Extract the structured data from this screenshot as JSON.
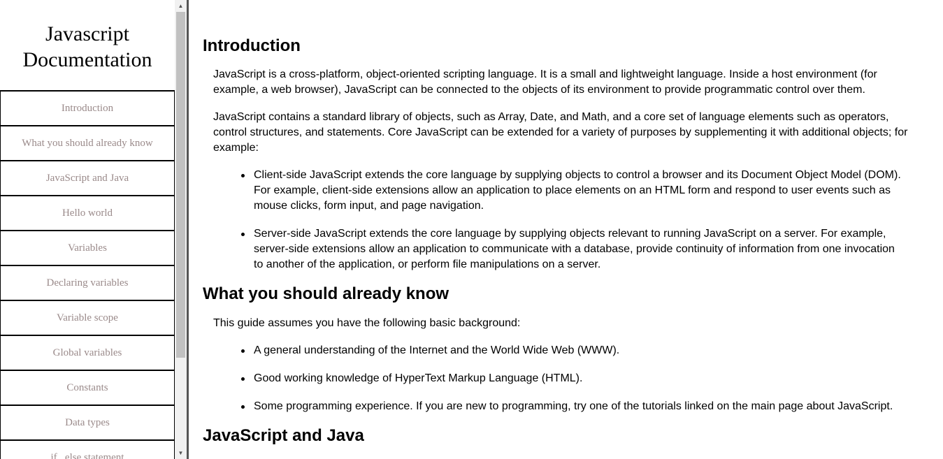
{
  "navbar": {
    "title_line1": "Javascript",
    "title_line2": "Documentation",
    "items": [
      "Introduction",
      "What you should already know",
      "JavaScript and Java",
      "Hello world",
      "Variables",
      "Declaring variables",
      "Variable scope",
      "Global variables",
      "Constants",
      "Data types",
      "if...else statement"
    ]
  },
  "main": {
    "introduction": {
      "title": "Introduction",
      "p1": "JavaScript is a cross-platform, object-oriented scripting language. It is a small and lightweight language. Inside a host environment (for example, a web browser), JavaScript can be connected to the objects of its environment to provide programmatic control over them.",
      "p2": "JavaScript contains a standard library of objects, such as Array, Date, and Math, and a core set of language elements such as operators, control structures, and statements. Core JavaScript can be extended for a variety of purposes by supplementing it with additional objects; for example:",
      "bullets": [
        "Client-side JavaScript extends the core language by supplying objects to control a browser and its Document Object Model (DOM). For example, client-side extensions allow an application to place elements on an HTML form and respond to user events such as mouse clicks, form input, and page navigation.",
        "Server-side JavaScript extends the core language by supplying objects relevant to running JavaScript on a server. For example, server-side extensions allow an application to communicate with a database, provide continuity of information from one invocation to another of the application, or perform file manipulations on a server."
      ]
    },
    "know": {
      "title": "What you should already know",
      "p1": "This guide assumes you have the following basic background:",
      "bullets": [
        "A general understanding of the Internet and the World Wide Web (WWW).",
        "Good working knowledge of HyperText Markup Language (HTML).",
        "Some programming experience. If you are new to programming, try one of the tutorials linked on the main page about JavaScript."
      ]
    },
    "java": {
      "title": "JavaScript and Java"
    }
  }
}
